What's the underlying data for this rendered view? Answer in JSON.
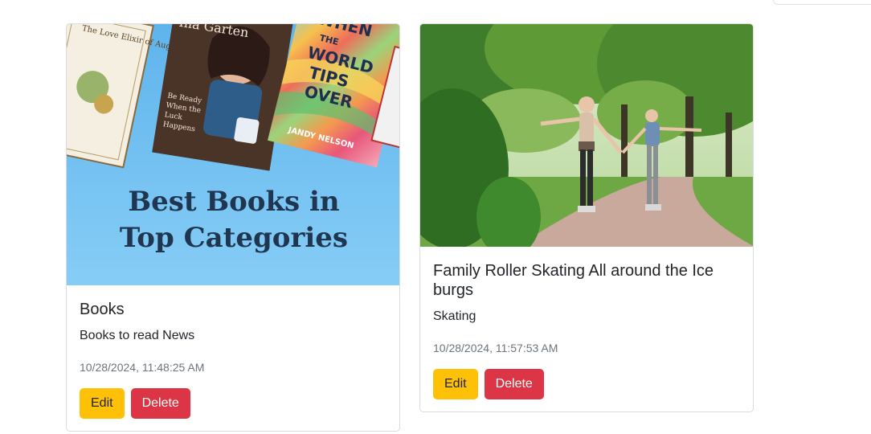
{
  "cards": [
    {
      "image_alt": "Best Books in Top Categories",
      "banner": {
        "line1": "Best Books in",
        "line2": "Top Categories",
        "book_left": "The Love Elixir of Augusta Stern",
        "book_center_author": "Ina Garten",
        "book_center_title": "Be Ready When the Luck Happens",
        "book_right_title": "WHEN THE WORLD TIPS OVER",
        "book_right_author": "JANDY NELSON"
      },
      "title": "Books",
      "category": "Books to read News",
      "date": "10/28/2024, 11:48:25 AM",
      "edit_label": "Edit",
      "delete_label": "Delete"
    },
    {
      "image_alt": "Mother and daughter roller skating in a park",
      "title": "Family Roller Skating All around the Ice burgs",
      "category": "Skating",
      "date": "10/28/2024, 11:57:53 AM",
      "edit_label": "Edit",
      "delete_label": "Delete"
    }
  ],
  "colors": {
    "edit": "#ffc107",
    "delete": "#dc3545",
    "banner_bg": "#7cc4f0",
    "banner_text": "#1f3550"
  }
}
